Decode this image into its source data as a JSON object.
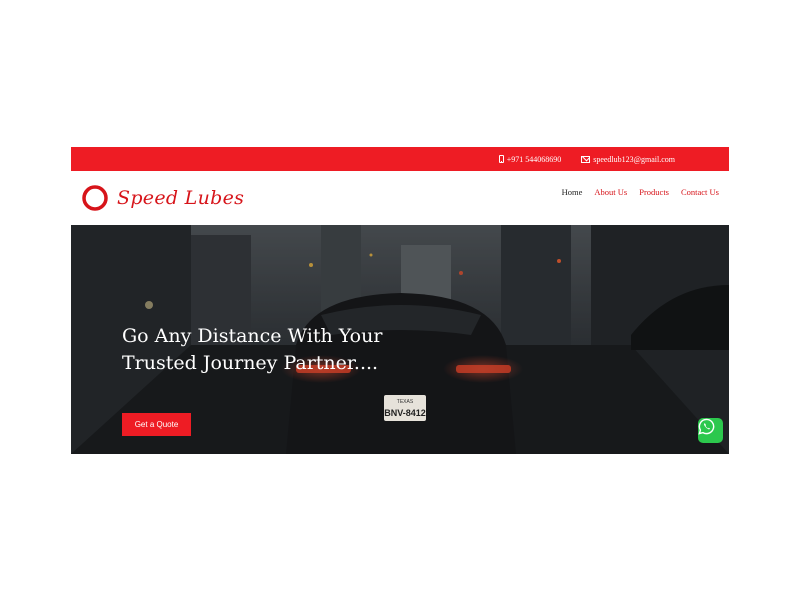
{
  "topbar": {
    "phone": "+971 544068690",
    "email": "speedlub123@gmail.com",
    "phone_icon": "phone-icon",
    "email_icon": "envelope-icon"
  },
  "brand": {
    "name": "Speed Lubes",
    "color": "#d7141a"
  },
  "nav": {
    "items": [
      {
        "label": "Home"
      },
      {
        "label": "About Us"
      },
      {
        "label": "Products"
      },
      {
        "label": "Contact Us"
      }
    ],
    "active": "Home"
  },
  "hero": {
    "title_line1": "Go Any Distance With Your",
    "title_line2": "Trusted Journey Partner....",
    "cta_label": "Get a Quote",
    "plate": "BNV-8412",
    "plate_state": "TEXAS"
  },
  "whatsapp": {
    "icon": "whatsapp-icon",
    "color": "#2cc84d"
  },
  "colors": {
    "accent": "#ee1c24"
  }
}
